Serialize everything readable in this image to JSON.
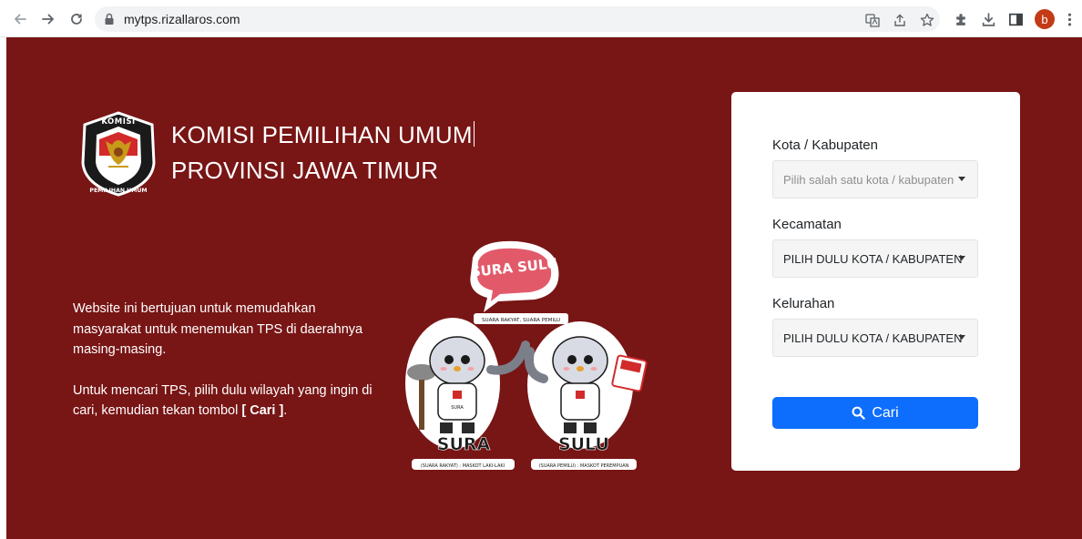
{
  "browser": {
    "url": "mytps.rizallaros.com",
    "avatar_letter": "b",
    "icons": [
      "back-icon",
      "forward-icon",
      "reload-icon",
      "lock-icon",
      "translate-icon",
      "share-icon",
      "star-icon",
      "extensions-icon",
      "download-icon",
      "side-panel-icon",
      "menu-icon"
    ]
  },
  "header": {
    "title_line1": "KOMISI PEMILIHAN UMUM",
    "title_line2": "PROVINSI JAWA TIMUR",
    "logo_top_text": "KOMISI",
    "logo_bottom_text": "PEMILIHAN UMUM"
  },
  "intro": {
    "paragraph1": "Website ini bertujuan untuk memudahkan masyarakat untuk menemukan TPS di daerahnya masing-masing.",
    "paragraph2_prefix": "Untuk mencari TPS, pilih dulu wilayah yang ingin di cari, kemudian tekan tombol ",
    "paragraph2_button": "[ Cari ]",
    "paragraph2_suffix": "."
  },
  "mascot": {
    "bubble_text": "SURA SULU",
    "bubble_caption": "SUARA RAKYAT, SUARA PEMILU",
    "left_name": "SURA",
    "left_caption": "(SUARA RAKYAT) : MASKOT LAKI-LAKI",
    "right_name": "SULU",
    "right_caption": "(SUARA PEMILU) : MASKOT PEREMPUAN",
    "shirt_text": "SURA"
  },
  "form": {
    "kota_label": "Kota / Kabupaten",
    "kota_value": "Pilih salah satu kota / kabupaten",
    "kecamatan_label": "Kecamatan",
    "kecamatan_value": "PILIH DULU KOTA / KABUPATEN",
    "kelurahan_label": "Kelurahan",
    "kelurahan_value": "PILIH DULU KOTA / KABUPATEN",
    "search_button": "Cari"
  },
  "colors": {
    "page_background": "#781515",
    "button_primary": "#0d6efd",
    "avatar": "#c33b16"
  }
}
